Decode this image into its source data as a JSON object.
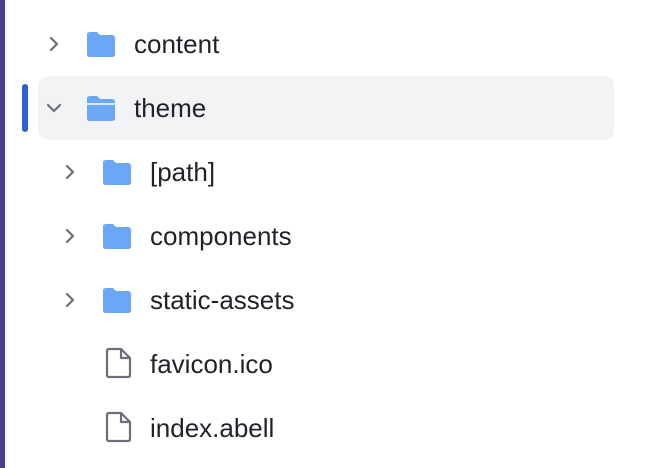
{
  "tree": {
    "items": [
      {
        "label": "content",
        "kind": "folder",
        "state": "collapsed",
        "icon": "folder-icon",
        "chevron": "chevron-right-icon"
      },
      {
        "label": "theme",
        "kind": "folder",
        "state": "expanded",
        "selected": true,
        "icon": "folder-open-icon",
        "chevron": "chevron-down-icon"
      },
      {
        "label": "[path]",
        "kind": "folder",
        "state": "collapsed",
        "icon": "folder-icon",
        "chevron": "chevron-right-icon"
      },
      {
        "label": "components",
        "kind": "folder",
        "state": "collapsed",
        "icon": "folder-icon",
        "chevron": "chevron-right-icon"
      },
      {
        "label": "static-assets",
        "kind": "folder",
        "state": "collapsed",
        "icon": "folder-icon",
        "chevron": "chevron-right-icon"
      },
      {
        "label": "favicon.ico",
        "kind": "file",
        "icon": "file-icon"
      },
      {
        "label": "index.abell",
        "kind": "file",
        "icon": "file-icon"
      }
    ]
  },
  "colors": {
    "folder": "#6aa8f5",
    "selected_bg": "#f2f3f5",
    "selection_indicator": "#2f5fd0",
    "left_rail": "#4a3f8f",
    "text": "#1f2328",
    "chevron": "#6b7078"
  }
}
